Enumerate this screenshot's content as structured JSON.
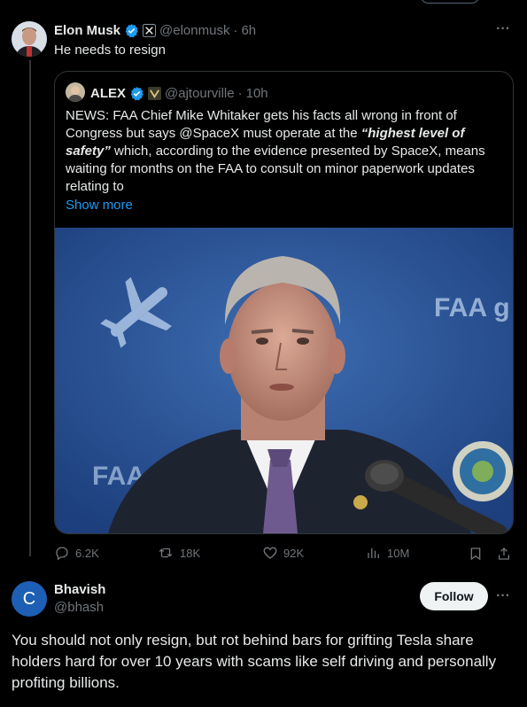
{
  "main_post": {
    "author_name": "Elon Musk",
    "handle": "@elonmusk",
    "time": "6h",
    "text": "He needs to resign",
    "more_label": "···"
  },
  "quoted_post": {
    "author_name": "ALEX",
    "handle": "@ajtourville",
    "time": "10h",
    "text_part1": "NEWS: FAA Chief Mike Whitaker gets his facts all wrong in front of Congress but says @SpaceX must operate at the ",
    "text_italic": "“highest level of safety”",
    "text_part2": " which, according to the evidence presented by SpaceX, means waiting for months on the FAA to consult on minor paperwork updates relating to",
    "show_more": "Show more",
    "image_text_1": "FAA g",
    "image_text_2": "FAA"
  },
  "actions": {
    "replies": "6.2K",
    "reposts": "18K",
    "likes": "92K",
    "views": "10M"
  },
  "reply": {
    "avatar_letter": "C",
    "author_name": "Bhavish",
    "handle": "@bhash",
    "follow_label": "Follow",
    "more_label": "···",
    "text": "You should not only resign, but rot behind bars for grifting Tesla share holders hard for over 10 years with scams like self driving and personally profiting billions."
  },
  "colors": {
    "background": "#000000",
    "text": "#e7e9ea",
    "muted": "#71767b",
    "link": "#1d9bf0",
    "verified": "#1d9bf0",
    "follow_bg": "#eff3f4"
  }
}
